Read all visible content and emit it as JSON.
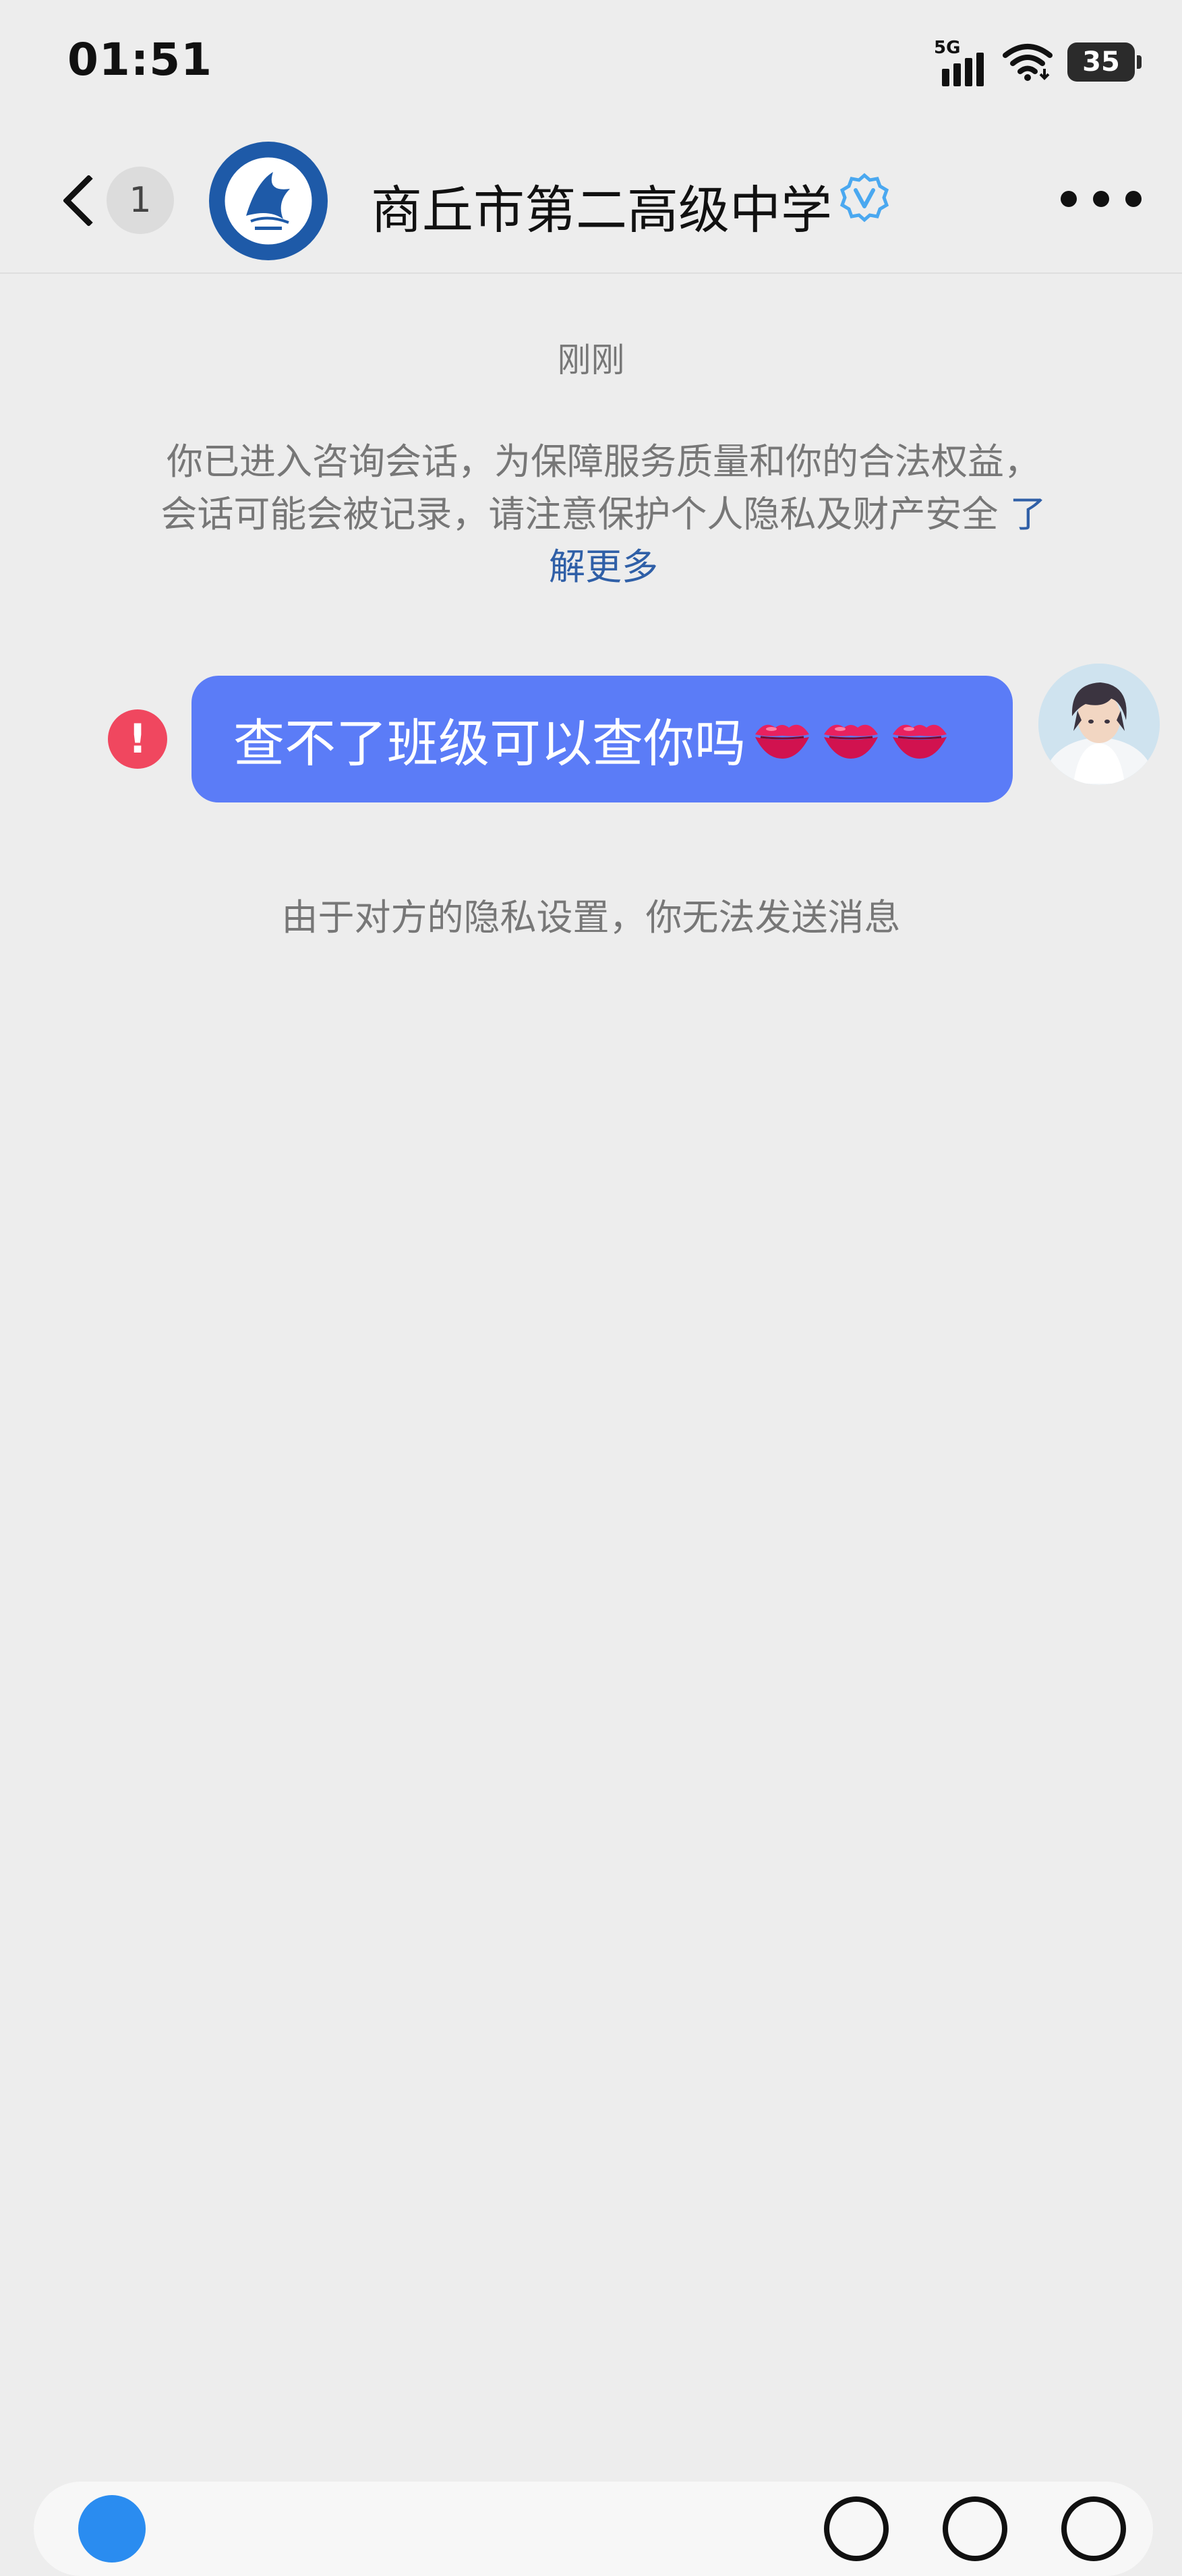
{
  "status_bar": {
    "time": "01:51",
    "network": "5G",
    "battery": "35"
  },
  "header": {
    "unread_count": "1",
    "title": "商丘市第二高级中学",
    "verified": true,
    "logo_icon": "school-emblem-icon",
    "more_icon": "more-dots-icon"
  },
  "chat": {
    "timestamp": "刚刚",
    "notice_text": "你已进入咨询会话，为保障服务质量和你的合法权益，会话可能会被记录，请注意保护个人隐私及财产安全",
    "notice_link": "了解更多",
    "message": {
      "text": "查不了班级可以查你吗",
      "emoji": "💋💋💋",
      "status": "failed",
      "bubble_color": "#5b7cf7"
    },
    "system_message": "由于对方的隐私设置，你无法发送消息"
  },
  "colors": {
    "background": "#ededed",
    "link": "#2f5fa7",
    "error": "#f0475f",
    "verified": "#4aa8f0"
  }
}
